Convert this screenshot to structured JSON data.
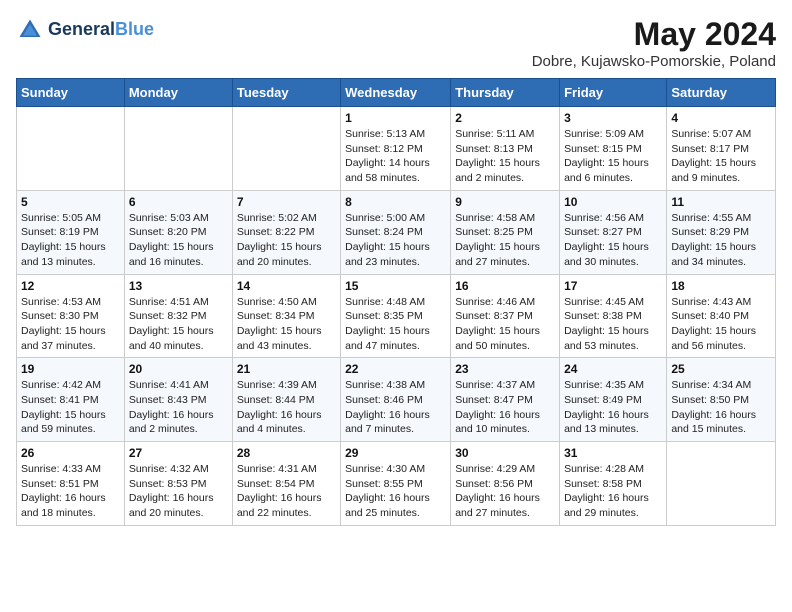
{
  "header": {
    "logo_line1": "General",
    "logo_line2": "Blue",
    "month": "May 2024",
    "location": "Dobre, Kujawsko-Pomorskie, Poland"
  },
  "days_of_week": [
    "Sunday",
    "Monday",
    "Tuesday",
    "Wednesday",
    "Thursday",
    "Friday",
    "Saturday"
  ],
  "weeks": [
    [
      {
        "day": "",
        "info": ""
      },
      {
        "day": "",
        "info": ""
      },
      {
        "day": "",
        "info": ""
      },
      {
        "day": "1",
        "info": "Sunrise: 5:13 AM\nSunset: 8:12 PM\nDaylight: 14 hours and 58 minutes."
      },
      {
        "day": "2",
        "info": "Sunrise: 5:11 AM\nSunset: 8:13 PM\nDaylight: 15 hours and 2 minutes."
      },
      {
        "day": "3",
        "info": "Sunrise: 5:09 AM\nSunset: 8:15 PM\nDaylight: 15 hours and 6 minutes."
      },
      {
        "day": "4",
        "info": "Sunrise: 5:07 AM\nSunset: 8:17 PM\nDaylight: 15 hours and 9 minutes."
      }
    ],
    [
      {
        "day": "5",
        "info": "Sunrise: 5:05 AM\nSunset: 8:19 PM\nDaylight: 15 hours and 13 minutes."
      },
      {
        "day": "6",
        "info": "Sunrise: 5:03 AM\nSunset: 8:20 PM\nDaylight: 15 hours and 16 minutes."
      },
      {
        "day": "7",
        "info": "Sunrise: 5:02 AM\nSunset: 8:22 PM\nDaylight: 15 hours and 20 minutes."
      },
      {
        "day": "8",
        "info": "Sunrise: 5:00 AM\nSunset: 8:24 PM\nDaylight: 15 hours and 23 minutes."
      },
      {
        "day": "9",
        "info": "Sunrise: 4:58 AM\nSunset: 8:25 PM\nDaylight: 15 hours and 27 minutes."
      },
      {
        "day": "10",
        "info": "Sunrise: 4:56 AM\nSunset: 8:27 PM\nDaylight: 15 hours and 30 minutes."
      },
      {
        "day": "11",
        "info": "Sunrise: 4:55 AM\nSunset: 8:29 PM\nDaylight: 15 hours and 34 minutes."
      }
    ],
    [
      {
        "day": "12",
        "info": "Sunrise: 4:53 AM\nSunset: 8:30 PM\nDaylight: 15 hours and 37 minutes."
      },
      {
        "day": "13",
        "info": "Sunrise: 4:51 AM\nSunset: 8:32 PM\nDaylight: 15 hours and 40 minutes."
      },
      {
        "day": "14",
        "info": "Sunrise: 4:50 AM\nSunset: 8:34 PM\nDaylight: 15 hours and 43 minutes."
      },
      {
        "day": "15",
        "info": "Sunrise: 4:48 AM\nSunset: 8:35 PM\nDaylight: 15 hours and 47 minutes."
      },
      {
        "day": "16",
        "info": "Sunrise: 4:46 AM\nSunset: 8:37 PM\nDaylight: 15 hours and 50 minutes."
      },
      {
        "day": "17",
        "info": "Sunrise: 4:45 AM\nSunset: 8:38 PM\nDaylight: 15 hours and 53 minutes."
      },
      {
        "day": "18",
        "info": "Sunrise: 4:43 AM\nSunset: 8:40 PM\nDaylight: 15 hours and 56 minutes."
      }
    ],
    [
      {
        "day": "19",
        "info": "Sunrise: 4:42 AM\nSunset: 8:41 PM\nDaylight: 15 hours and 59 minutes."
      },
      {
        "day": "20",
        "info": "Sunrise: 4:41 AM\nSunset: 8:43 PM\nDaylight: 16 hours and 2 minutes."
      },
      {
        "day": "21",
        "info": "Sunrise: 4:39 AM\nSunset: 8:44 PM\nDaylight: 16 hours and 4 minutes."
      },
      {
        "day": "22",
        "info": "Sunrise: 4:38 AM\nSunset: 8:46 PM\nDaylight: 16 hours and 7 minutes."
      },
      {
        "day": "23",
        "info": "Sunrise: 4:37 AM\nSunset: 8:47 PM\nDaylight: 16 hours and 10 minutes."
      },
      {
        "day": "24",
        "info": "Sunrise: 4:35 AM\nSunset: 8:49 PM\nDaylight: 16 hours and 13 minutes."
      },
      {
        "day": "25",
        "info": "Sunrise: 4:34 AM\nSunset: 8:50 PM\nDaylight: 16 hours and 15 minutes."
      }
    ],
    [
      {
        "day": "26",
        "info": "Sunrise: 4:33 AM\nSunset: 8:51 PM\nDaylight: 16 hours and 18 minutes."
      },
      {
        "day": "27",
        "info": "Sunrise: 4:32 AM\nSunset: 8:53 PM\nDaylight: 16 hours and 20 minutes."
      },
      {
        "day": "28",
        "info": "Sunrise: 4:31 AM\nSunset: 8:54 PM\nDaylight: 16 hours and 22 minutes."
      },
      {
        "day": "29",
        "info": "Sunrise: 4:30 AM\nSunset: 8:55 PM\nDaylight: 16 hours and 25 minutes."
      },
      {
        "day": "30",
        "info": "Sunrise: 4:29 AM\nSunset: 8:56 PM\nDaylight: 16 hours and 27 minutes."
      },
      {
        "day": "31",
        "info": "Sunrise: 4:28 AM\nSunset: 8:58 PM\nDaylight: 16 hours and 29 minutes."
      },
      {
        "day": "",
        "info": ""
      }
    ]
  ]
}
